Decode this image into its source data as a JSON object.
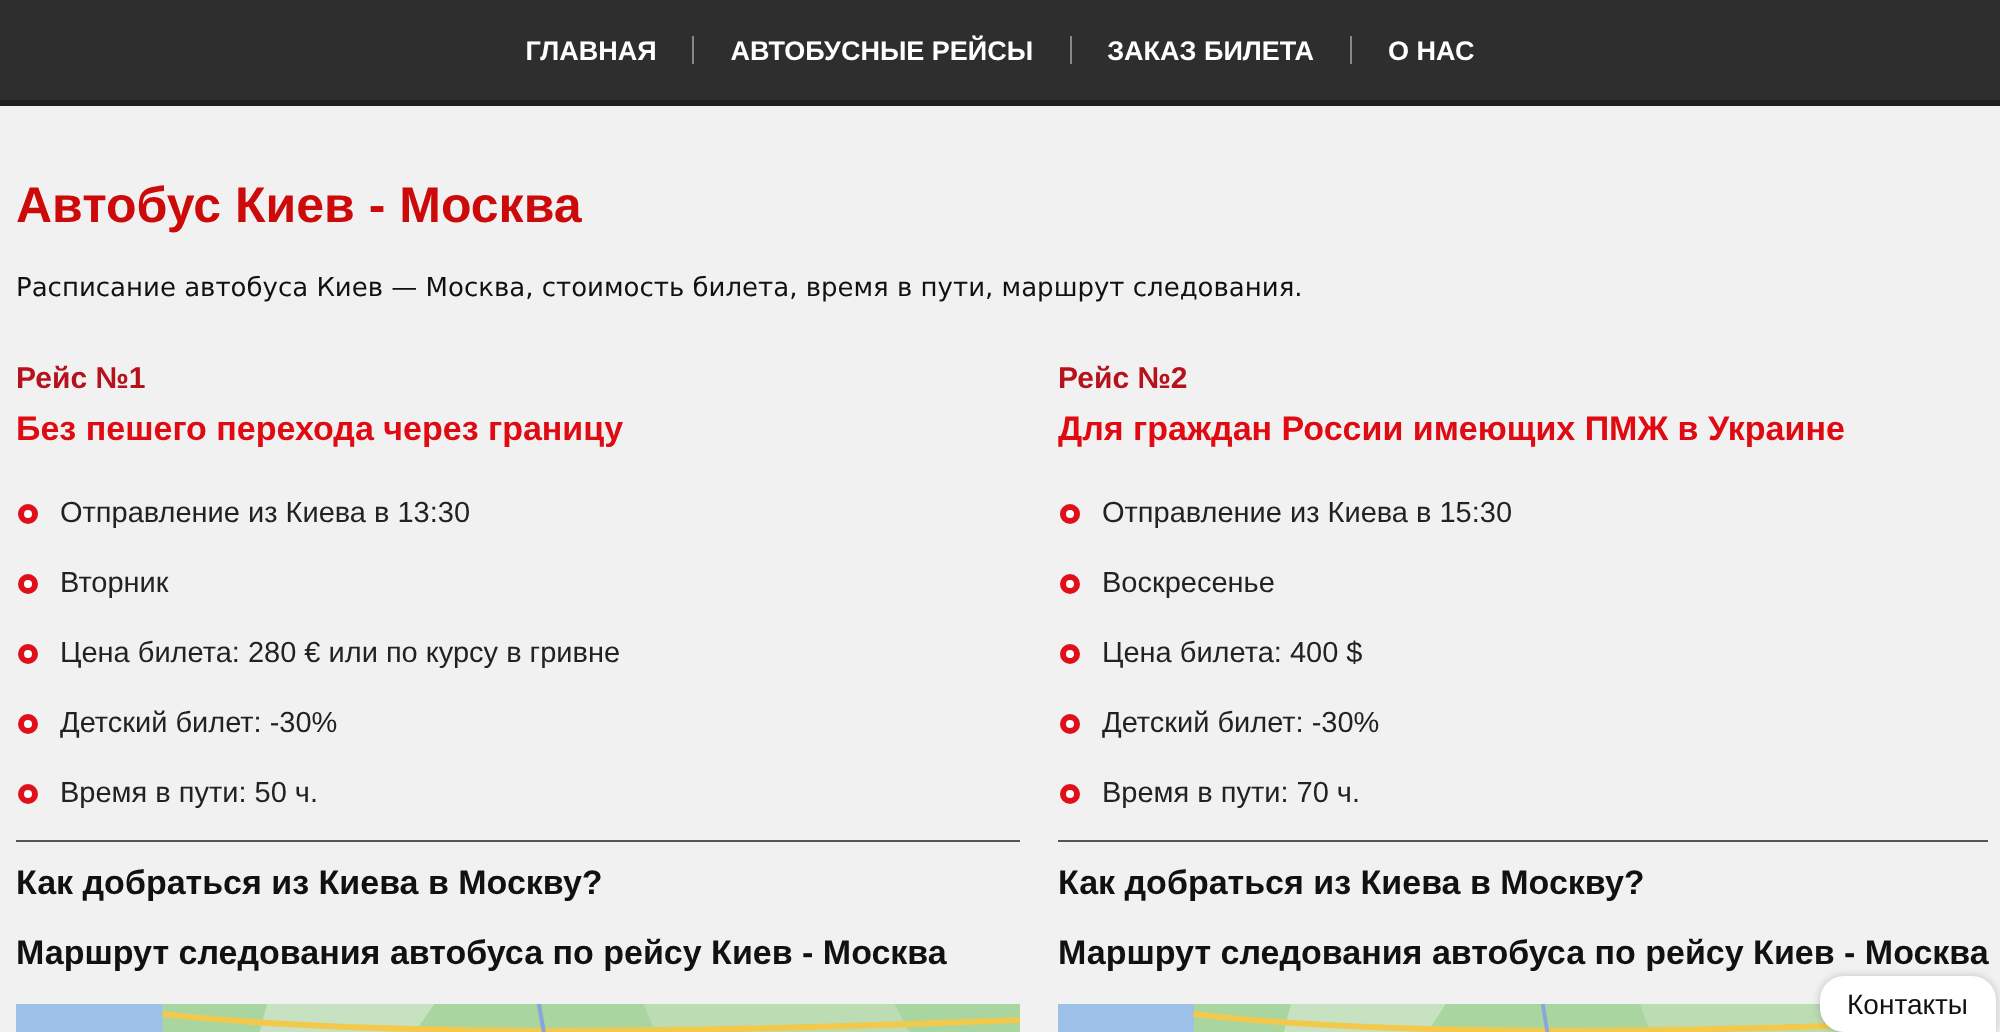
{
  "nav": [
    {
      "label": "ГЛАВНАЯ"
    },
    {
      "label": "АВТОБУСНЫЕ РЕЙСЫ"
    },
    {
      "label": "ЗАКАЗ БИЛЕТА"
    },
    {
      "label": "О НАС"
    }
  ],
  "title": "Автобус Киев - Москва",
  "description": "Расписание автобуса Киев — Москва, стоимость билета, время в пути, маршрут следования.",
  "routes": [
    {
      "number": "Рейс №1",
      "subtitle": "Без пешего перехода через границу",
      "facts": [
        "Отправление из Киева в 13:30",
        "Вторник",
        "Цена билета: 280 € или по курсу в гривне",
        "Детский билет: -30%",
        "Время в пути: 50 ч."
      ],
      "question": "Как добраться из Киева в Москву?",
      "map_heading": "Маршрут следования автобуса по рейсу Киев - Москва"
    },
    {
      "number": "Рейс №2",
      "subtitle": "Для граждан России имеющих ПМЖ в Украине",
      "facts": [
        "Отправление из Киева в 15:30",
        "Воскресенье",
        "Цена билета: 400 $",
        "Детский билет: -30%",
        "Время в пути: 70 ч."
      ],
      "question": "Как добраться из Киева в Москву?",
      "map_heading": "Маршрут следования автобуса по рейсу Киев - Москва"
    }
  ],
  "contacts_button": "Контакты"
}
